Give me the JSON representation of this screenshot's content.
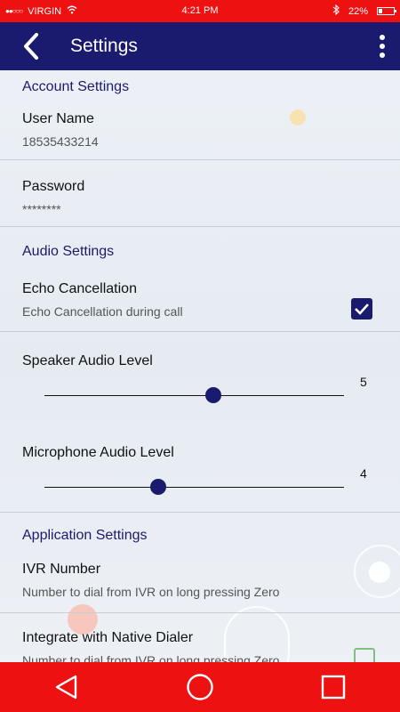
{
  "status_bar": {
    "carrier": "VIRGIN",
    "time": "4:21 PM",
    "battery": "22%",
    "battery_level": 0.22
  },
  "app_bar": {
    "title": "Settings"
  },
  "sections": {
    "account": {
      "header": "Account Settings",
      "username_label": "User Name",
      "username_value": "18535433214",
      "password_label": "Password",
      "password_value": "********"
    },
    "audio": {
      "header": "Audio Settings",
      "echo_label": "Echo Cancellation",
      "echo_sub": "Echo Cancellation during call",
      "echo_checked": true,
      "speaker_label": "Speaker Audio Level",
      "speaker_value": "5",
      "microphone_label": "Microphone Audio Level",
      "microphone_value": "4"
    },
    "application": {
      "header": "Application Settings",
      "ivr_label": "IVR Number",
      "ivr_sub": "Number to dial from IVR on long pressing Zero",
      "native_label": "Integrate with Native Dialer",
      "native_sub": "Number to dial from IVR on long pressing Zero",
      "native_checked": false
    }
  },
  "colors": {
    "status_bar": "#ee1111",
    "app_bar": "#1a1a6e",
    "accent": "#1a1a6e"
  }
}
